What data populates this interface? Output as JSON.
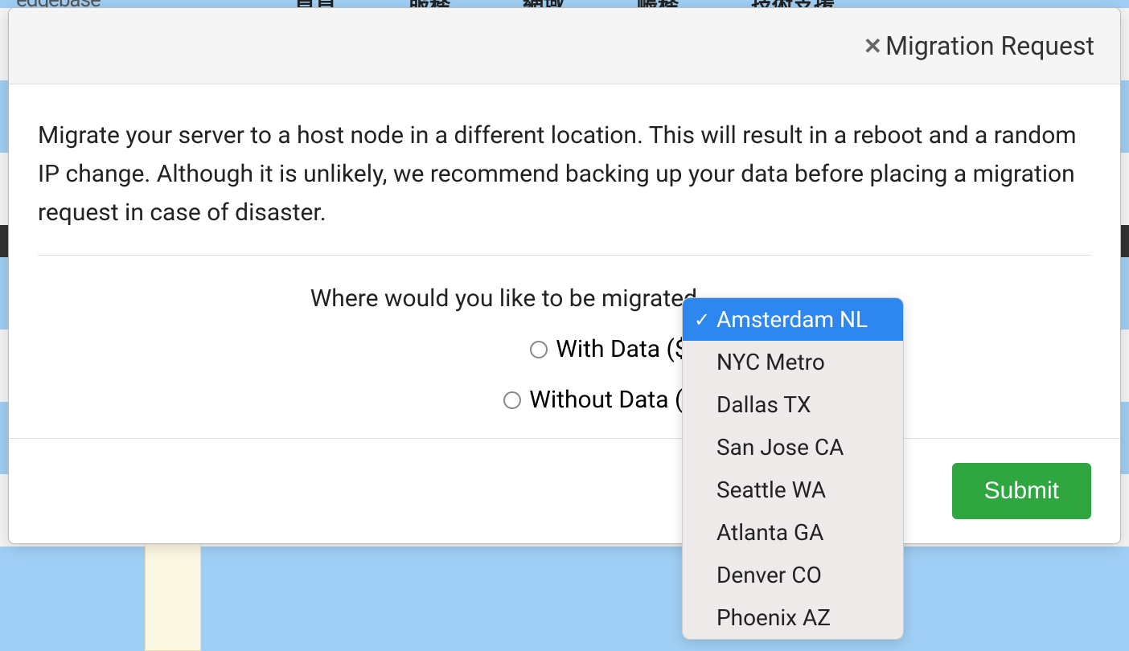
{
  "background": {
    "logo": "edgebase",
    "nav": [
      "首頁",
      "服務",
      "網域",
      "帳務",
      "技術支援"
    ]
  },
  "modal": {
    "title": "Migration Request",
    "description": "Migrate your server to a host node in a different location. This will result in a reboot and a random IP change. Although it is unlikely, we recommend backing up your data before placing a migration request in case of disaster.",
    "location_question": "Where would you like to be migrated",
    "radio_options": {
      "with_data": "With Data ($5)",
      "without_data": "Without Data ($3"
    },
    "dropdown": {
      "options": [
        "Amsterdam NL",
        "NYC Metro",
        "Dallas TX",
        "San Jose CA",
        "Seattle WA",
        "Atlanta GA",
        "Denver CO",
        "Phoenix AZ"
      ],
      "selected_index": 0
    },
    "submit_label": "Submit"
  }
}
